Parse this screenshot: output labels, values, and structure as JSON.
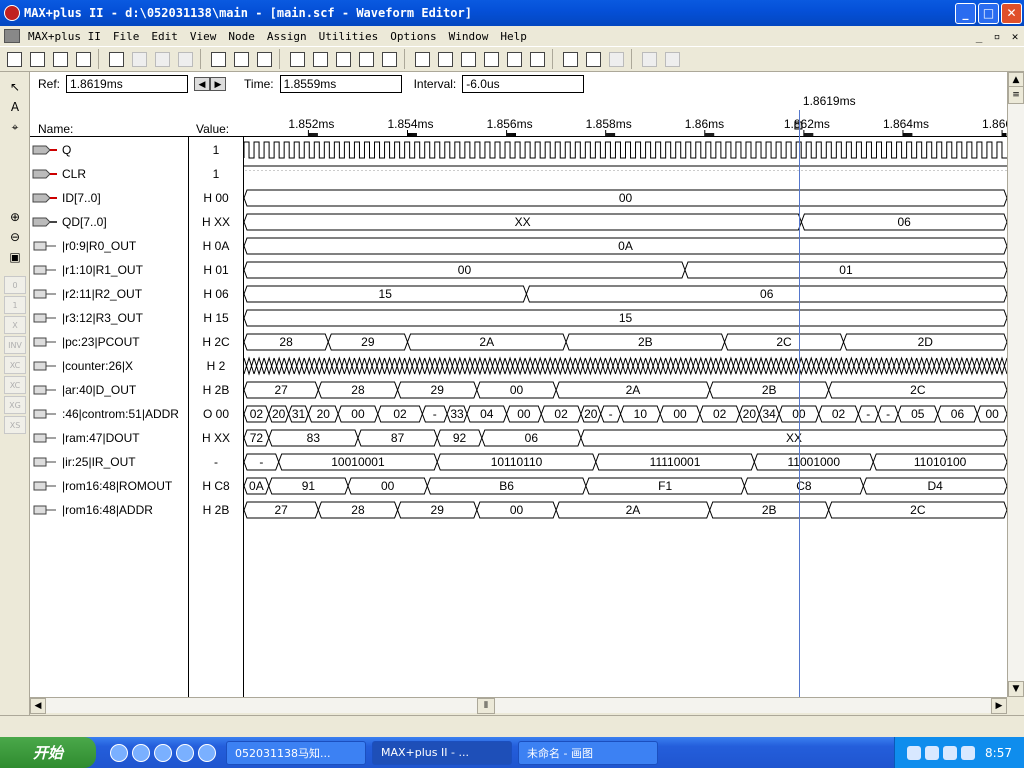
{
  "window": {
    "title": "MAX+plus II - d:\\052031138\\main - [main.scf - Waveform Editor]",
    "min": "_",
    "max": "□",
    "close": "✕"
  },
  "menu": [
    "MAX+plus II",
    "File",
    "Edit",
    "View",
    "Node",
    "Assign",
    "Utilities",
    "Options",
    "Window",
    "Help"
  ],
  "mdi": {
    "min": "_",
    "restore": "▫",
    "close": "✕"
  },
  "toolbar_icons": [
    "new-icon",
    "open-icon",
    "save-icon",
    "print-icon",
    "cut-icon",
    "copy-icon",
    "paste-icon",
    "undo-icon",
    "help-pointer-icon",
    "warning-icon",
    "compile-icon",
    "simulate-icon",
    "timing-icon",
    "programmer-icon",
    "hierarchy-icon",
    "floorplan-icon",
    "project-save-check-icon",
    "project-save-compile-icon",
    "project-save-simulate-icon",
    "project-save-icon",
    "assign-icon",
    "pin-assign-icon",
    "timing-assign-icon",
    "logic-assign-icon",
    "tile-icon",
    "cascade-icon",
    "zoom-icon"
  ],
  "left_tools": [
    "pointer-icon",
    "text-tool-icon",
    "node-find-icon",
    "zoom-in-icon",
    "zoom-out-icon",
    "fit-window-icon",
    "low-icon",
    "high-icon",
    "x-icon",
    "invert-icon",
    "count-icon",
    "clock-icon",
    "group-icon",
    "seq-icon"
  ],
  "left_tool_labels": [
    "",
    "A",
    "",
    "",
    "",
    "",
    "0",
    "1",
    "X",
    "INV",
    "XC",
    "XC",
    "XG",
    "XS"
  ],
  "refbar": {
    "ref_label": "Ref:",
    "ref_value": "1.8619ms",
    "time_label": "Time:",
    "time_value": "1.8559ms",
    "interval_label": "Interval:",
    "interval_value": "-6.0us"
  },
  "headers": {
    "name": "Name:",
    "value": "Value:"
  },
  "cursor_label": "1.8619ms",
  "timeline": {
    "ticks": [
      "1.852ms",
      "1.854ms",
      "1.856ms",
      "1.858ms",
      "1.86ms",
      "1.862ms",
      "1.864ms",
      "1.866r"
    ],
    "start": 1.8507,
    "end": 1.8661,
    "cursor": 1.8619
  },
  "rows": [
    {
      "name": "Q",
      "value": "1",
      "type": "clock",
      "pin": "input",
      "periods": 76
    },
    {
      "name": "CLR",
      "value": "1",
      "type": "high",
      "pin": "input"
    },
    {
      "name": "ID[7..0]",
      "value": "H 00",
      "type": "bus",
      "pin": "bus-input",
      "segs": [
        [
          "00",
          1.8507,
          1.8661
        ]
      ]
    },
    {
      "name": "QD[7..0]",
      "value": "H XX",
      "type": "bus",
      "pin": "bus-output",
      "segs": [
        [
          "XX",
          1.8507,
          1.86195
        ],
        [
          "06",
          1.86195,
          1.8661
        ]
      ]
    },
    {
      "name": "|r0:9|R0_OUT",
      "value": "H 0A",
      "type": "bus",
      "pin": "buried",
      "segs": [
        [
          "0A",
          1.8507,
          1.8661
        ]
      ]
    },
    {
      "name": "|r1:10|R1_OUT",
      "value": "H 01",
      "type": "bus",
      "pin": "buried",
      "segs": [
        [
          "00",
          1.8507,
          1.8596
        ],
        [
          "01",
          1.8596,
          1.8661
        ]
      ]
    },
    {
      "name": "|r2:11|R2_OUT",
      "value": "H 06",
      "type": "bus",
      "pin": "buried",
      "segs": [
        [
          "15",
          1.8507,
          1.8564
        ],
        [
          "06",
          1.8564,
          1.8661
        ]
      ]
    },
    {
      "name": "|r3:12|R3_OUT",
      "value": "H 15",
      "type": "bus",
      "pin": "buried",
      "segs": [
        [
          "15",
          1.8507,
          1.8661
        ]
      ]
    },
    {
      "name": "|pc:23|PCOUT",
      "value": "H 2C",
      "type": "bus",
      "pin": "buried",
      "segs": [
        [
          "28",
          1.8507,
          1.8524
        ],
        [
          "29",
          1.8524,
          1.854
        ],
        [
          "2A",
          1.854,
          1.8572
        ],
        [
          "2B",
          1.8572,
          1.8604
        ],
        [
          "2C",
          1.8604,
          1.8628
        ],
        [
          "2D",
          1.8628,
          1.8661
        ]
      ]
    },
    {
      "name": "|counter:26|X",
      "value": "H 2",
      "type": "dense",
      "pin": "buried",
      "periods": 76
    },
    {
      "name": "|ar:40|D_OUT",
      "value": "H 2B",
      "type": "bus",
      "pin": "buried",
      "segs": [
        [
          "27",
          1.8507,
          1.8522
        ],
        [
          "28",
          1.8522,
          1.8538
        ],
        [
          "29",
          1.8538,
          1.8554
        ],
        [
          "00",
          1.8554,
          1.857
        ],
        [
          "2A",
          1.857,
          1.8601
        ],
        [
          "2B",
          1.8601,
          1.8625
        ],
        [
          "2C",
          1.8625,
          1.8661
        ]
      ]
    },
    {
      "name": ":46|controm:51|ADDR",
      "value": "O 00",
      "type": "bus",
      "pin": "buried",
      "segs": [
        [
          "02",
          1.8507,
          1.8512
        ],
        [
          "20",
          1.8512,
          1.8516
        ],
        [
          "31",
          1.8516,
          1.852
        ],
        [
          "20",
          1.852,
          1.8526
        ],
        [
          "00",
          1.8526,
          1.8534
        ],
        [
          "02",
          1.8534,
          1.8543
        ],
        [
          "-",
          1.8543,
          1.8548
        ],
        [
          "33",
          1.8548,
          1.8552
        ],
        [
          "04",
          1.8552,
          1.856
        ],
        [
          "00",
          1.856,
          1.8567
        ],
        [
          "02",
          1.8567,
          1.8575
        ],
        [
          "20",
          1.8575,
          1.8579
        ],
        [
          "-",
          1.8579,
          1.8583
        ],
        [
          "10",
          1.8583,
          1.8591
        ],
        [
          "00",
          1.8591,
          1.8599
        ],
        [
          "02",
          1.8599,
          1.8607
        ],
        [
          "20",
          1.8607,
          1.8611
        ],
        [
          "34",
          1.8611,
          1.8615
        ],
        [
          "00",
          1.8615,
          1.8623
        ],
        [
          "02",
          1.8623,
          1.8631
        ],
        [
          "-",
          1.8631,
          1.8635
        ],
        [
          "-",
          1.8635,
          1.8639
        ],
        [
          "05",
          1.8639,
          1.8647
        ],
        [
          "06",
          1.8647,
          1.8655
        ],
        [
          "00",
          1.8655,
          1.8661
        ]
      ]
    },
    {
      "name": "|ram:47|DOUT",
      "value": "H XX",
      "type": "bus",
      "pin": "buried",
      "segs": [
        [
          "72",
          1.8507,
          1.8512
        ],
        [
          "83",
          1.8512,
          1.853
        ],
        [
          "87",
          1.853,
          1.8546
        ],
        [
          "92",
          1.8546,
          1.8555
        ],
        [
          "06",
          1.8555,
          1.8575
        ],
        [
          "XX",
          1.8575,
          1.8661
        ]
      ]
    },
    {
      "name": "|ir:25|IR_OUT",
      "value": "-",
      "type": "bus",
      "pin": "buried",
      "segs": [
        [
          "-",
          1.8507,
          1.8514
        ],
        [
          "10010001",
          1.8514,
          1.8546
        ],
        [
          "10110110",
          1.8546,
          1.8578
        ],
        [
          "11110001",
          1.8578,
          1.861
        ],
        [
          "11001000",
          1.861,
          1.8634
        ],
        [
          "11010100",
          1.8634,
          1.8661
        ]
      ]
    },
    {
      "name": "|rom16:48|ROMOUT",
      "value": "H C8",
      "type": "bus",
      "pin": "buried",
      "segs": [
        [
          "0A",
          1.8507,
          1.8512
        ],
        [
          "91",
          1.8512,
          1.8528
        ],
        [
          "00",
          1.8528,
          1.8544
        ],
        [
          "B6",
          1.8544,
          1.8576
        ],
        [
          "F1",
          1.8576,
          1.8608
        ],
        [
          "C8",
          1.8608,
          1.8632
        ],
        [
          "D4",
          1.8632,
          1.8661
        ]
      ]
    },
    {
      "name": "|rom16:48|ADDR",
      "value": "H 2B",
      "type": "bus",
      "pin": "buried",
      "segs": [
        [
          "27",
          1.8507,
          1.8522
        ],
        [
          "28",
          1.8522,
          1.8538
        ],
        [
          "29",
          1.8538,
          1.8554
        ],
        [
          "00",
          1.8554,
          1.857
        ],
        [
          "2A",
          1.857,
          1.8601
        ],
        [
          "2B",
          1.8601,
          1.8625
        ],
        [
          "2C",
          1.8625,
          1.8661
        ]
      ]
    }
  ],
  "taskbar": {
    "start": "开始",
    "tasks": [
      "052031138马知...",
      "MAX+plus II - ...",
      "未命名 - 画图"
    ],
    "clock": "8:57"
  }
}
